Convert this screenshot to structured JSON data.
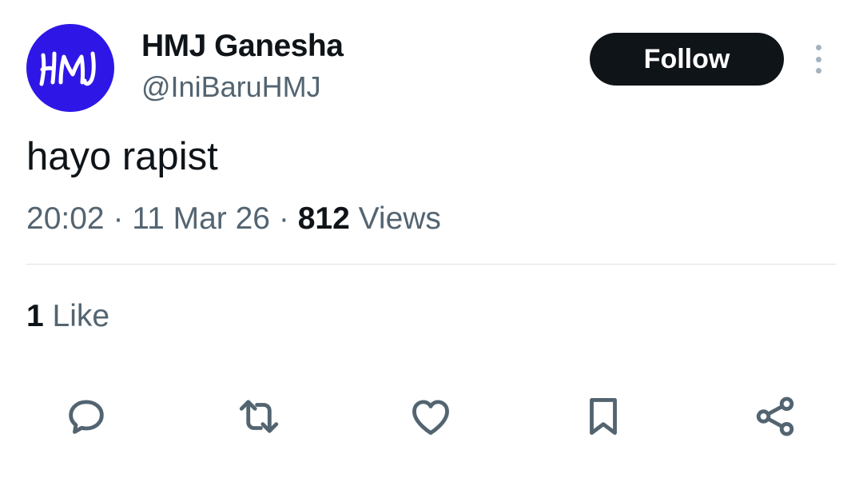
{
  "author": {
    "avatar_text": "HMJ",
    "avatar_color": "#2e17e6",
    "display_name": "HMJ Ganesha",
    "handle": "@IniBaruHMJ"
  },
  "actions_top": {
    "follow_label": "Follow",
    "more_icon": "more-vertical-icon"
  },
  "tweet": {
    "text": "hayo rapist",
    "time": "20:02",
    "date": "11 Mar 26",
    "separator": "·",
    "views_count": "812",
    "views_label": "Views"
  },
  "engagement": {
    "like_count": "1",
    "like_label": "Like"
  },
  "action_bar": {
    "icons": [
      "reply-icon",
      "retweet-icon",
      "like-icon",
      "bookmark-icon",
      "share-icon"
    ],
    "icon_color": "#536471"
  },
  "colors": {
    "text_primary": "#0f1419",
    "text_secondary": "#536471",
    "follow_bg": "#0f1419"
  }
}
